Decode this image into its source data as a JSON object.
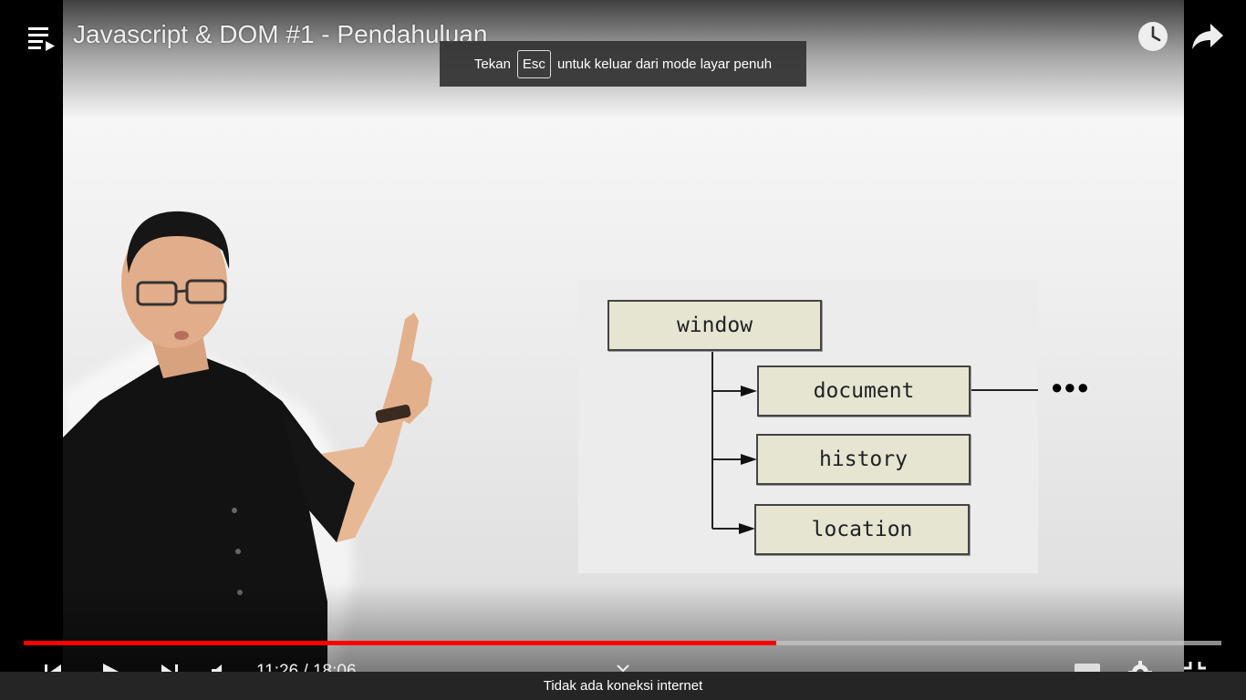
{
  "video": {
    "title": "Javascript & DOM #1 - Pendahuluan",
    "progress_fraction": 0.6286,
    "time": {
      "current": "11:26",
      "separator": " / ",
      "duration": "18:06"
    }
  },
  "fullscreen_toast": {
    "before": "Tekan",
    "key": "Esc",
    "after": "untuk keluar dari mode layar penuh"
  },
  "diagram": {
    "root": "window",
    "children": [
      "document",
      "history",
      "location"
    ],
    "ellipsis": "●●●"
  },
  "status": {
    "message": "Tidak ada koneksi internet"
  },
  "colors": {
    "progress": "#ff0000",
    "status_bg": "#252525"
  },
  "icons": {
    "playlist": "playlist-icon",
    "watch_later": "clock-icon",
    "share": "share-icon",
    "prev": "skip-previous-icon",
    "play": "play-icon",
    "next": "skip-next-icon",
    "volume": "volume-icon",
    "settings": "gear-icon",
    "fullscreen": "fullscreen-exit-icon"
  }
}
